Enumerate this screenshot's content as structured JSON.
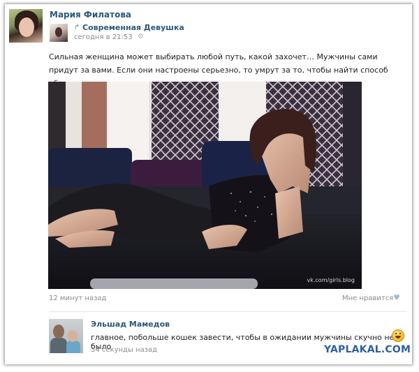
{
  "post": {
    "author": "Мария Филатова",
    "group": "Современная Девушка",
    "time": "сегодня в 21:53",
    "text": "Сильная женщина может выбирать любой путь, какой захочет… Мужчины сами придут за вами. Если они настроены серьезно, то умрут за то, чтобы найти способ обладать вами.",
    "photo_credit": "vk.com/girls.blog",
    "footer_time": "12 минут назад",
    "like_label": "Мне нравится"
  },
  "comment": {
    "author": "Эльшад Мамедов",
    "text": "главное, побольше кошек завести, чтобы в ожидании мужчины скучно не было",
    "time": "34 секунды назад"
  },
  "watermark": "YAPLAKAL.COM",
  "icons": {
    "repost": "repost-icon",
    "gear": "gear-icon",
    "heart": "heart-icon",
    "emoji": "laughing-emoji-icon"
  },
  "colors": {
    "link": "#2b587a",
    "muted": "#8c8c8c",
    "watermark": "#2f5f9f"
  }
}
